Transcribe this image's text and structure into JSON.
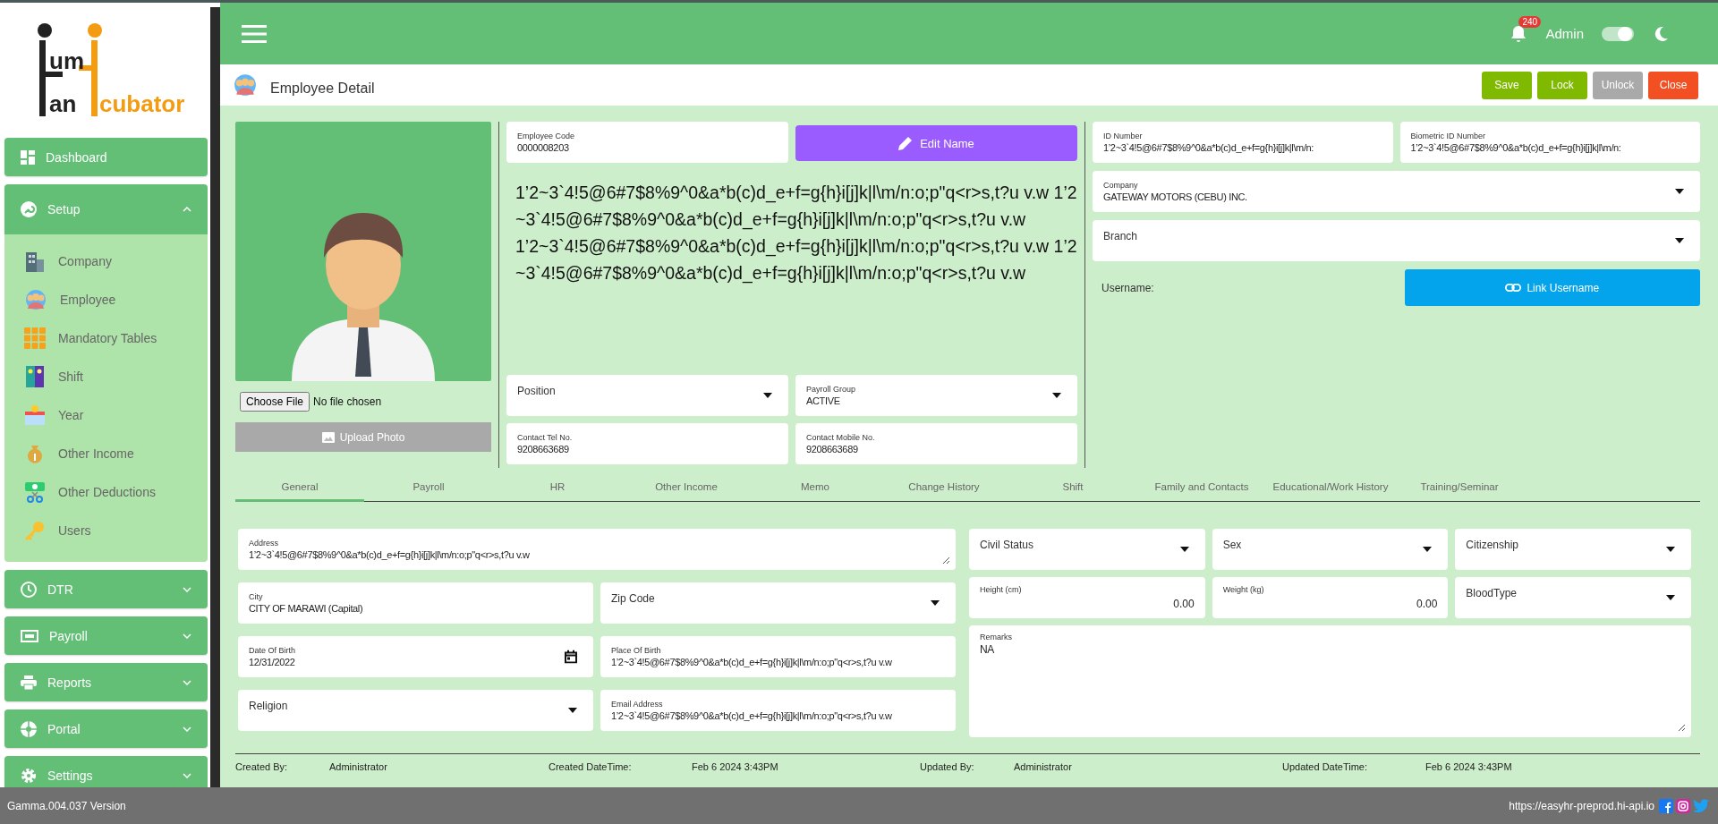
{
  "header": {
    "notification_count": "240",
    "user": "Admin"
  },
  "sidebar": {
    "logo": {
      "parts": [
        "um",
        "an",
        "cubator"
      ]
    },
    "dashboard": {
      "label": "Dashboard"
    },
    "groups": [
      {
        "label": "Setup",
        "expanded": true,
        "children": [
          {
            "label": "Company"
          },
          {
            "label": "Employee"
          },
          {
            "label": "Mandatory Tables"
          },
          {
            "label": "Shift"
          },
          {
            "label": "Year"
          },
          {
            "label": "Other Income"
          },
          {
            "label": "Other Deductions"
          },
          {
            "label": "Users"
          }
        ]
      },
      {
        "label": "DTR",
        "expanded": false
      },
      {
        "label": "Payroll",
        "expanded": false
      },
      {
        "label": "Reports",
        "expanded": false
      },
      {
        "label": "Portal",
        "expanded": false
      },
      {
        "label": "Settings",
        "expanded": false
      }
    ]
  },
  "page": {
    "title": "Employee Detail",
    "buttons": [
      {
        "label": "Save",
        "kind": "save",
        "disabled": false
      },
      {
        "label": "Lock",
        "kind": "lock",
        "disabled": false
      },
      {
        "label": "Unlock",
        "kind": "unlock",
        "disabled": true
      },
      {
        "label": "Close",
        "kind": "close",
        "disabled": false
      }
    ]
  },
  "photo": {
    "file_button": "Choose File",
    "file_status": "No file chosen",
    "upload_button": {
      "label": "Upload Photo",
      "disabled": true
    }
  },
  "employee": {
    "code": {
      "label": "Employee Code",
      "value": "0000008203",
      "kind": "text"
    },
    "edit_name": "Edit Name",
    "name_lines": [
      "1’2~3`4!5@6#7$8%9^0&a*b(c)d_e+f=g{h}i[j]k|l\\m/n:o;p\"q<r>s,t?u v.w 1’2~3`4!5@6#7$8%9^0&a*b(c)d_e+f=g{h}i[j]k|l\\m/n:o;p\"q<r>s,t?u v.w",
      "1’2~3`4!5@6#7$8%9^0&a*b(c)d_e+f=g{h}i[j]k|l\\m/n:o;p\"q<r>s,t?u v.w 1’2~3`4!5@6#7$8%9^0&a*b(c)d_e+f=g{h}i[j]k|l\\m/n:o;p\"q<r>s,t?u v.w"
    ],
    "fields": [
      {
        "label": "Position",
        "kind": "select"
      },
      {
        "label": "Payroll Group",
        "value": "ACTIVE",
        "kind": "select"
      },
      {
        "label": "Contact Tel No.",
        "value": "9208663689",
        "kind": "text"
      },
      {
        "label": "Contact Mobile No.",
        "value": "9208663689",
        "kind": "text"
      }
    ]
  },
  "identity": {
    "fields": [
      {
        "label": "ID Number",
        "value": "1’2~3`4!5@6#7$8%9^0&a*b(c)d_e+f=g{h}i[j]k|l\\m/n:",
        "kind": "text"
      },
      {
        "label": "Biometric ID Number",
        "value": "1’2~3`4!5@6#7$8%9^0&a*b(c)d_e+f=g{h}i[j]k|l\\m/n:",
        "kind": "text"
      },
      {
        "label": "Company",
        "value": "GATEWAY MOTORS (CEBU) INC.",
        "kind": "select"
      },
      {
        "label": "Branch",
        "kind": "select"
      }
    ],
    "username_label": "Username:",
    "link_button": "Link Username"
  },
  "tabs": [
    {
      "label": "General",
      "selected": true
    },
    {
      "label": "Payroll",
      "selected": false
    },
    {
      "label": "HR",
      "selected": false
    },
    {
      "label": "Other Income",
      "selected": false
    },
    {
      "label": "Memo",
      "selected": false
    },
    {
      "label": "Change History",
      "selected": false
    },
    {
      "label": "Shift",
      "selected": false
    },
    {
      "label": "Family and Contacts",
      "selected": false
    },
    {
      "label": "Educational/Work History",
      "selected": false
    },
    {
      "label": "Training/Seminar",
      "selected": false
    }
  ],
  "general": {
    "left_fields": [
      {
        "label": "Address",
        "value": "1’2~3`4!5@6#7$8%9^0&a*b(c)d_e+f=g{h}i[j]k|l\\m/n:o;p\"q<r>s,t?u v.w",
        "kind": "textarea"
      },
      {
        "label": "City",
        "value": "CITY OF MARAWI (Capital)",
        "kind": "text"
      },
      {
        "label": "Zip Code",
        "kind": "select"
      },
      {
        "label": "Date Of Birth",
        "value": "12/31/2022",
        "kind": "date"
      },
      {
        "label": "Place Of Birth",
        "value": "1’2~3`4!5@6#7$8%9^0&a*b(c)d_e+f=g{h}i[j]k|l\\m/n:o;p\"q<r>s,t?u v.w",
        "kind": "text"
      },
      {
        "label": "Religion",
        "kind": "select"
      },
      {
        "label": "Email Address",
        "value": "1’2~3`4!5@6#7$8%9^0&a*b(c)d_e+f=g{h}i[j]k|l\\m/n:o;p\"q<r>s,t?u v.w",
        "kind": "text"
      }
    ],
    "right_fields": [
      {
        "label": "Civil Status",
        "kind": "select"
      },
      {
        "label": "Sex",
        "kind": "select"
      },
      {
        "label": "Citizenship",
        "kind": "select"
      },
      {
        "label": "Height (cm)",
        "value": "0.00",
        "kind": "number"
      },
      {
        "label": "Weight (kg)",
        "value": "0.00",
        "kind": "number"
      },
      {
        "label": "BloodType",
        "kind": "select"
      },
      {
        "label": "Remarks",
        "value": "NA",
        "kind": "textarea"
      }
    ]
  },
  "audit": [
    {
      "label": "Created By:",
      "value": "Administrator"
    },
    {
      "label": "Created DateTime:",
      "value": "Feb 6 2024 3:43PM"
    },
    {
      "label": "Updated By:",
      "value": "Administrator"
    },
    {
      "label": "Updated DateTime:",
      "value": "Feb 6 2024 3:43PM"
    }
  ],
  "footer": {
    "version": "Gamma.004.037 Version",
    "url": "https://easyhr-preprod.hi-api.io"
  }
}
